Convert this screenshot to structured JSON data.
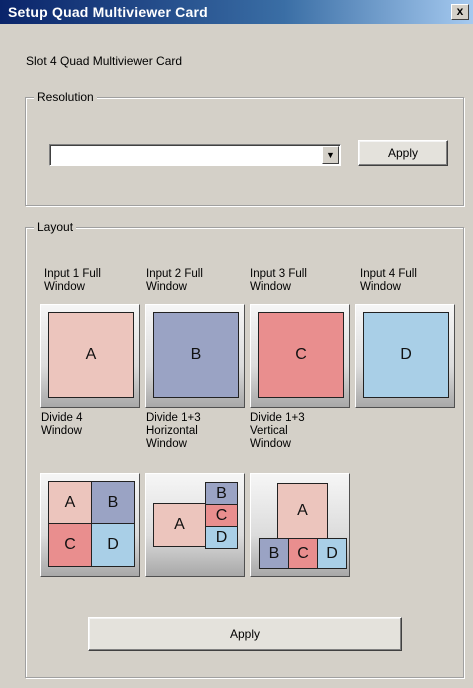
{
  "window": {
    "title": "Setup Quad Multiviewer Card",
    "close_glyph": "x"
  },
  "slot_label": "Slot 4 Quad Multiviewer Card",
  "resolution": {
    "group_title": "Resolution",
    "selected_value": "",
    "dropdown_glyph": "▼",
    "apply_label": "Apply"
  },
  "layout": {
    "group_title": "Layout",
    "options": [
      {
        "label_lines": [
          "Input 1 Full",
          "Window"
        ],
        "letters": [
          "A"
        ]
      },
      {
        "label_lines": [
          "Input 2 Full",
          "Window"
        ],
        "letters": [
          "B"
        ]
      },
      {
        "label_lines": [
          "Input 3 Full",
          "Window"
        ],
        "letters": [
          "C"
        ]
      },
      {
        "label_lines": [
          "Input 4 Full",
          "Window"
        ],
        "letters": [
          "D"
        ]
      },
      {
        "label_lines": [
          "Divide 4",
          "Window"
        ],
        "letters": [
          "A",
          "B",
          "C",
          "D"
        ]
      },
      {
        "label_lines": [
          "Divide 1+3",
          "Horizontal",
          "Window"
        ],
        "letters": [
          "A",
          "B",
          "C",
          "D"
        ]
      },
      {
        "label_lines": [
          "Divide 1+3",
          "Vertical",
          "Window"
        ],
        "letters": [
          "A",
          "B",
          "C",
          "D"
        ]
      }
    ],
    "colors": {
      "A": "#ecc5bd",
      "B": "#9aa3c4",
      "C": "#e98e8e",
      "D": "#a9cfe7"
    }
  },
  "apply_label": "Apply"
}
